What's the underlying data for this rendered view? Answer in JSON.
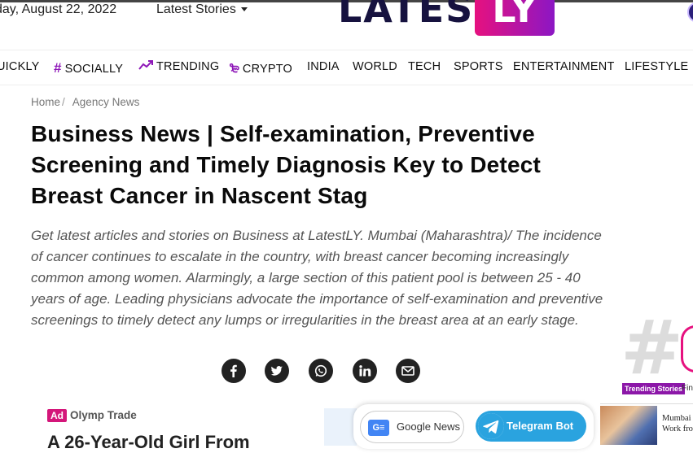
{
  "header": {
    "date": "day, August 22, 2022",
    "latest_stories": "Latest Stories",
    "logo_text": "LATEST",
    "logo_badge": "LY"
  },
  "nav": {
    "items": [
      {
        "label": "UICKLY",
        "icon": ""
      },
      {
        "label": "SOCIALLY",
        "icon": "hash-icon"
      },
      {
        "label": "TRENDING",
        "icon": "trending-icon"
      },
      {
        "label": "CRYPTO",
        "icon": "crypto-icon"
      },
      {
        "label": "INDIA",
        "icon": ""
      },
      {
        "label": "WORLD",
        "icon": ""
      },
      {
        "label": "TECH",
        "icon": ""
      },
      {
        "label": "SPORTS",
        "icon": ""
      },
      {
        "label": "ENTERTAINMENT",
        "icon": ""
      },
      {
        "label": "LIFESTYLE",
        "icon": ""
      }
    ]
  },
  "breadcrumb": {
    "home": "Home",
    "section": "Agency News"
  },
  "article": {
    "title": "Business News | Self-examination, Preventive Screening and Timely Diagnosis Key to Detect Breast Cancer in Nascent Stag",
    "lead": "Get latest articles and stories on Business at LatestLY. Mumbai (Maharashtra)/ The incidence of cancer continues to escalate in the country, with breast cancer becoming increasingly common among women. Alarmingly, a large section of this patient pool is between 25 - 40 years of age. Leading physicians advocate the importance of self-examination and preventive screenings to timely detect any lumps or irregularities in the breast area at an early stage."
  },
  "share": [
    "facebook-icon",
    "twitter-icon",
    "whatsapp-icon",
    "linkedin-icon",
    "email-icon"
  ],
  "ad": {
    "badge": "Ad",
    "sponsor": "Olymp Trade",
    "headline": "A 26-Year-Old Girl From"
  },
  "follow_bar": {
    "google_news": "Google News",
    "telegram": "Telegram Bot"
  },
  "trending": {
    "tag": "Trending Stories",
    "next": "Fin"
  },
  "side_story": {
    "line1": "Mumbai",
    "line2": "Work fro"
  },
  "colors": {
    "brand_purple": "#8e17b8",
    "brand_pink": "#e6117f",
    "telegram_blue": "#2aa3df"
  }
}
